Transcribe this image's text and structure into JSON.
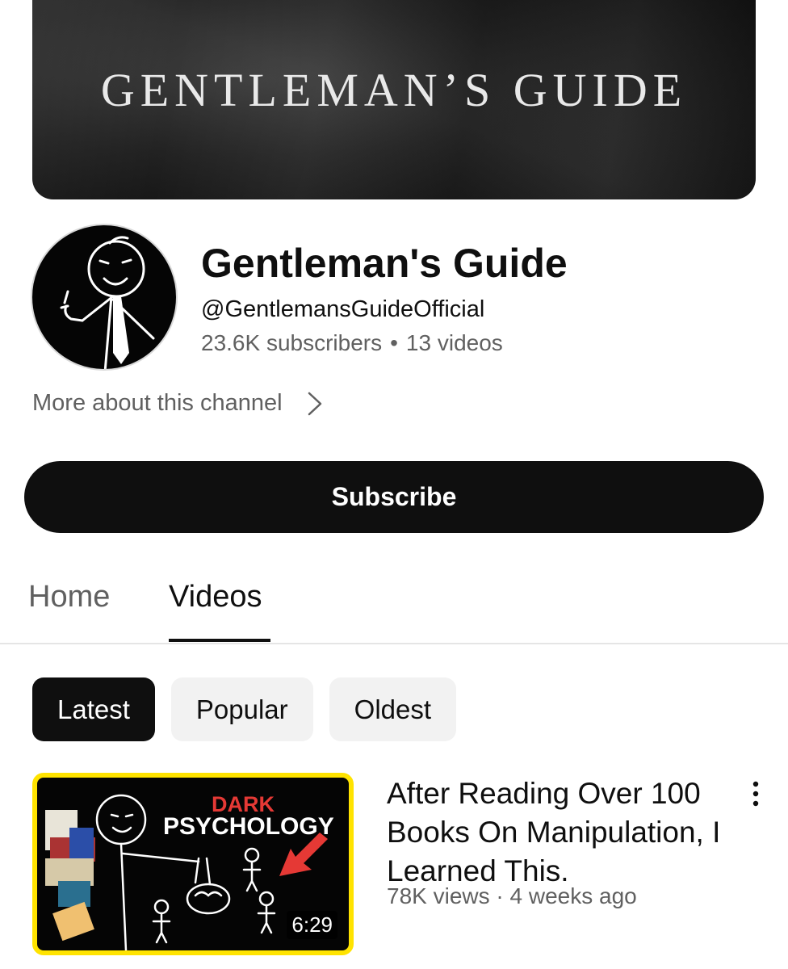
{
  "banner": {
    "title": "GENTLEMAN’S GUIDE"
  },
  "channel": {
    "name": "Gentleman's Guide",
    "handle": "@GentlemansGuideOfficial",
    "subscribers": "23.6K subscribers",
    "separator": "•",
    "videos": "13 videos",
    "more_about": "More about this channel"
  },
  "subscribe": {
    "label": "Subscribe"
  },
  "tabs": [
    {
      "label": "Home",
      "active": false
    },
    {
      "label": "Videos",
      "active": true
    }
  ],
  "chips": [
    {
      "label": "Latest",
      "active": true
    },
    {
      "label": "Popular",
      "active": false
    },
    {
      "label": "Oldest",
      "active": false
    }
  ],
  "videos": [
    {
      "title": "After Reading Over 100 Books On Manipulation, I Learned This.",
      "views": "78K views",
      "meta_separator": "·",
      "age": "4 weeks ago",
      "duration": "6:29",
      "thumbnail_text": {
        "line1": "DARK",
        "line2": "PSYCHOLOGY"
      }
    }
  ],
  "colors": {
    "accent": "#0f0f0f",
    "secondary_text": "#606060",
    "chip_bg": "#f2f2f2",
    "thumb_border": "#ffe300",
    "thumb_red": "#e53935"
  },
  "icons": [
    "chevron-right-icon",
    "more-vert-icon",
    "avatar-stickman-icon"
  ]
}
